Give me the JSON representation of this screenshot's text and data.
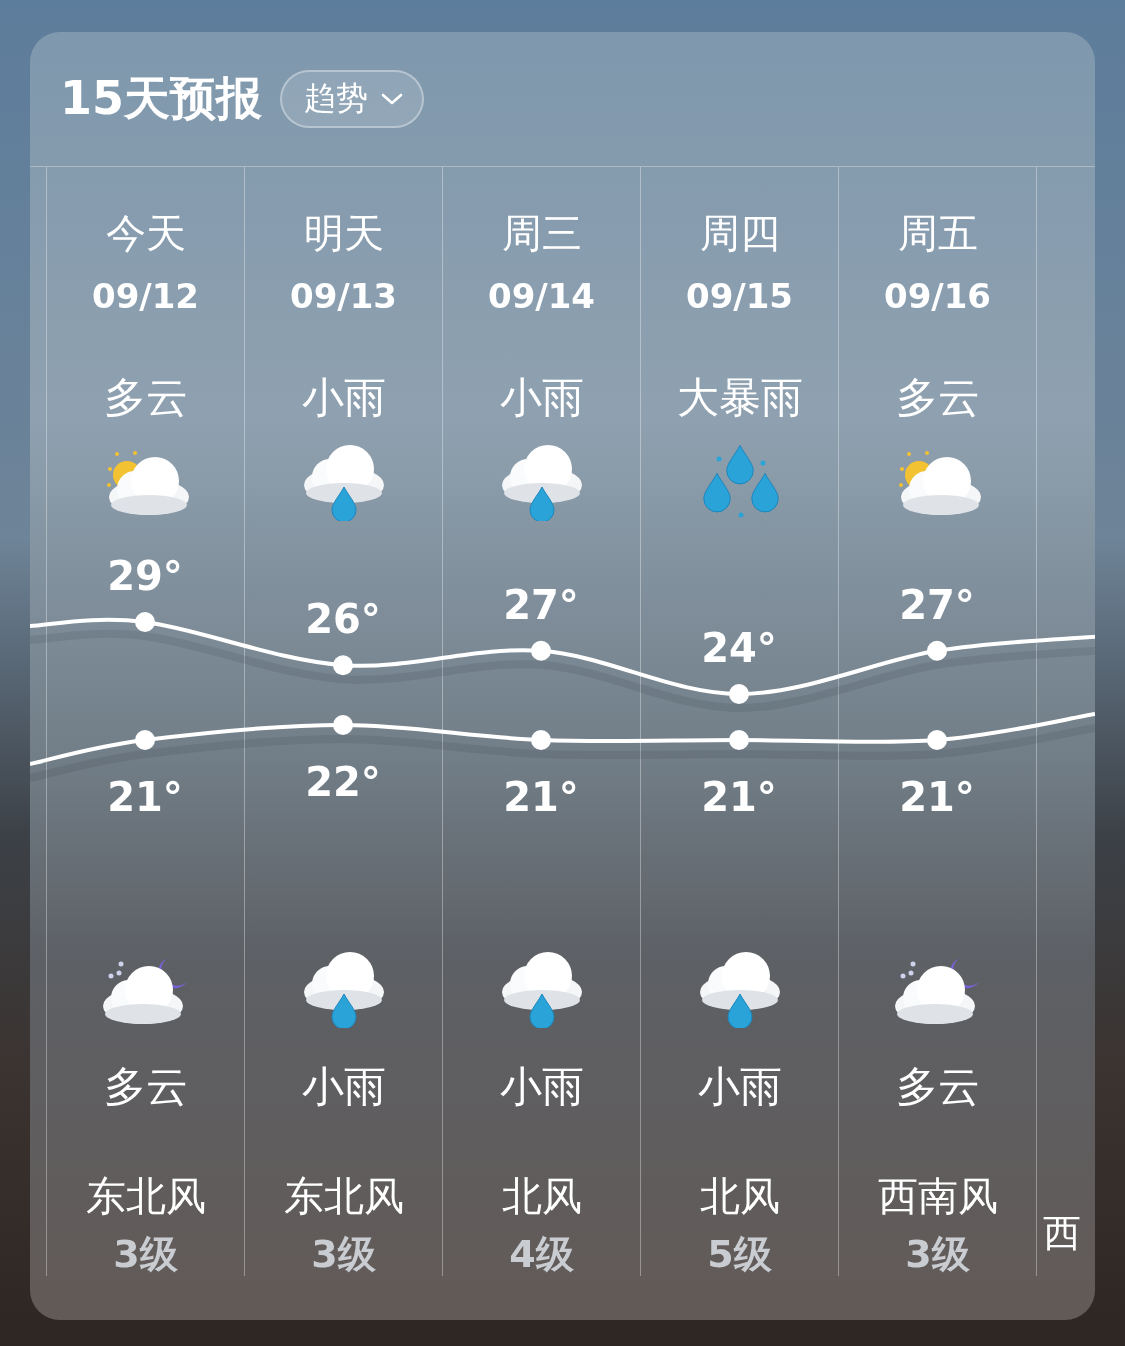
{
  "header": {
    "title": "15天预报",
    "trend_button": {
      "label": "趋势"
    }
  },
  "days": [
    {
      "day": "今天",
      "date": "09/12",
      "day_weather": "多云",
      "day_icon": {
        "kind": "partly-cloudy"
      },
      "high": "29°",
      "low": "21°",
      "night_icon": {
        "kind": "cloudy-night"
      },
      "night_weather": "多云",
      "wind_direction": "东北风",
      "wind_level": "3级"
    },
    {
      "day": "明天",
      "date": "09/13",
      "day_weather": "小雨",
      "day_icon": {
        "kind": "light-rain"
      },
      "high": "26°",
      "low": "22°",
      "night_icon": {
        "kind": "light-rain"
      },
      "night_weather": "小雨",
      "wind_direction": "东北风",
      "wind_level": "3级"
    },
    {
      "day": "周三",
      "date": "09/14",
      "day_weather": "小雨",
      "day_icon": {
        "kind": "light-rain"
      },
      "high": "27°",
      "low": "21°",
      "night_icon": {
        "kind": "light-rain"
      },
      "night_weather": "小雨",
      "wind_direction": "北风",
      "wind_level": "4级"
    },
    {
      "day": "周四",
      "date": "09/15",
      "day_weather": "大暴雨",
      "day_icon": {
        "kind": "heavy-rain"
      },
      "high": "24°",
      "low": "21°",
      "night_icon": {
        "kind": "light-rain"
      },
      "night_weather": "小雨",
      "wind_direction": "北风",
      "wind_level": "5级"
    },
    {
      "day": "周五",
      "date": "09/16",
      "day_weather": "多云",
      "day_icon": {
        "kind": "partly-cloudy"
      },
      "high": "27°",
      "low": "21°",
      "night_icon": {
        "kind": "cloudy-night"
      },
      "night_weather": "多云",
      "wind_direction": "西南风",
      "wind_level": "3级"
    }
  ],
  "partial_day": {
    "wind_direction": "西"
  }
}
